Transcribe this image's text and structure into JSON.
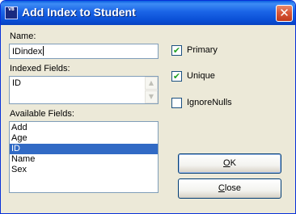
{
  "window": {
    "title": "Add Index to Student",
    "icon": "vbapp-icon",
    "icon_text": "VB"
  },
  "form": {
    "name_label": "Name:",
    "name_value": "IDindex",
    "indexed_label": "Indexed Fields:",
    "indexed_value": "ID",
    "available_label": "Available Fields:",
    "available_fields": [
      {
        "label": "Add",
        "selected": false
      },
      {
        "label": "Age",
        "selected": false
      },
      {
        "label": "ID",
        "selected": true
      },
      {
        "label": "Name",
        "selected": false
      },
      {
        "label": "Sex",
        "selected": false
      }
    ]
  },
  "options": {
    "primary": {
      "label": "Primary",
      "checked": true
    },
    "unique": {
      "label": "Unique",
      "checked": true
    },
    "ignore_nulls": {
      "label": "IgnoreNulls",
      "checked": false
    }
  },
  "buttons": {
    "ok_mnemonic": "O",
    "ok_rest": "K",
    "close_mnemonic": "C",
    "close_rest": "lose"
  },
  "colors": {
    "titlebar": "#0a4fd6",
    "selection": "#316ac5",
    "dialog_bg": "#ece9d8"
  }
}
